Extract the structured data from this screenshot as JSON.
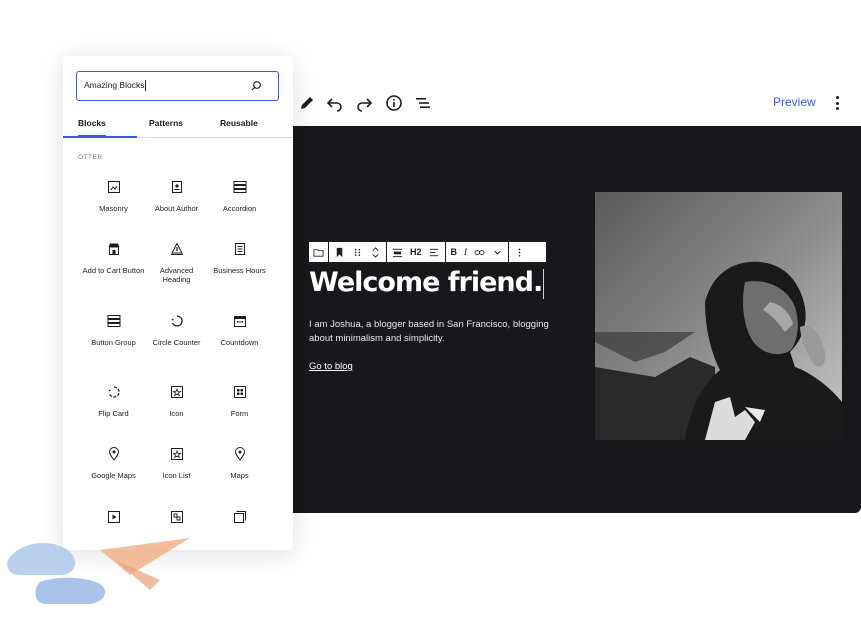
{
  "toolbar": {
    "preview_label": "Preview",
    "icons": [
      "pencil-icon",
      "undo-icon",
      "redo-icon",
      "info-icon",
      "list-view-icon",
      "more-vertical-icon"
    ]
  },
  "inserter": {
    "search": {
      "value": "Amazing Blocks"
    },
    "tabs": [
      "Blocks",
      "Patterns",
      "Reusable"
    ],
    "active_tab": "Blocks",
    "category": "OTTER",
    "blocks": [
      {
        "label": "Masonry",
        "icon": "masonry-icon"
      },
      {
        "label": "About Author",
        "icon": "about-author-icon"
      },
      {
        "label": "Accordion",
        "icon": "accordion-icon"
      },
      {
        "label": "Add to Cart Button",
        "icon": "add-to-cart-icon"
      },
      {
        "label": "Advanced Heading",
        "icon": "advanced-heading-icon"
      },
      {
        "label": "Business Hours",
        "icon": "business-hours-icon"
      },
      {
        "label": "Button Group",
        "icon": "button-group-icon"
      },
      {
        "label": "Circle Counter",
        "icon": "circle-counter-icon"
      },
      {
        "label": "Countdown",
        "icon": "countdown-icon"
      },
      {
        "label": "Flip Card",
        "icon": "flip-card-icon"
      },
      {
        "label": "Icon",
        "icon": "icon-block-icon"
      },
      {
        "label": "Form",
        "icon": "form-icon"
      },
      {
        "label": "Google Maps",
        "icon": "google-maps-icon"
      },
      {
        "label": "Icon List",
        "icon": "icon-list-icon"
      },
      {
        "label": "Maps",
        "icon": "maps-icon"
      },
      {
        "label": "",
        "icon": "video-icon"
      },
      {
        "label": "",
        "icon": "puzzle-icon"
      },
      {
        "label": "",
        "icon": "layers-icon"
      }
    ]
  },
  "canvas": {
    "block_toolbar": {
      "heading_level": "H2"
    },
    "headline": "Welcome friend.",
    "intro": "I am Joshua, a blogger based in San Francisco, blogging about minimalism and simplicity.",
    "link": "Go to blog",
    "background": "#17181b"
  },
  "colors": {
    "accent": "#3858e9",
    "text": "#1e1e1e"
  }
}
